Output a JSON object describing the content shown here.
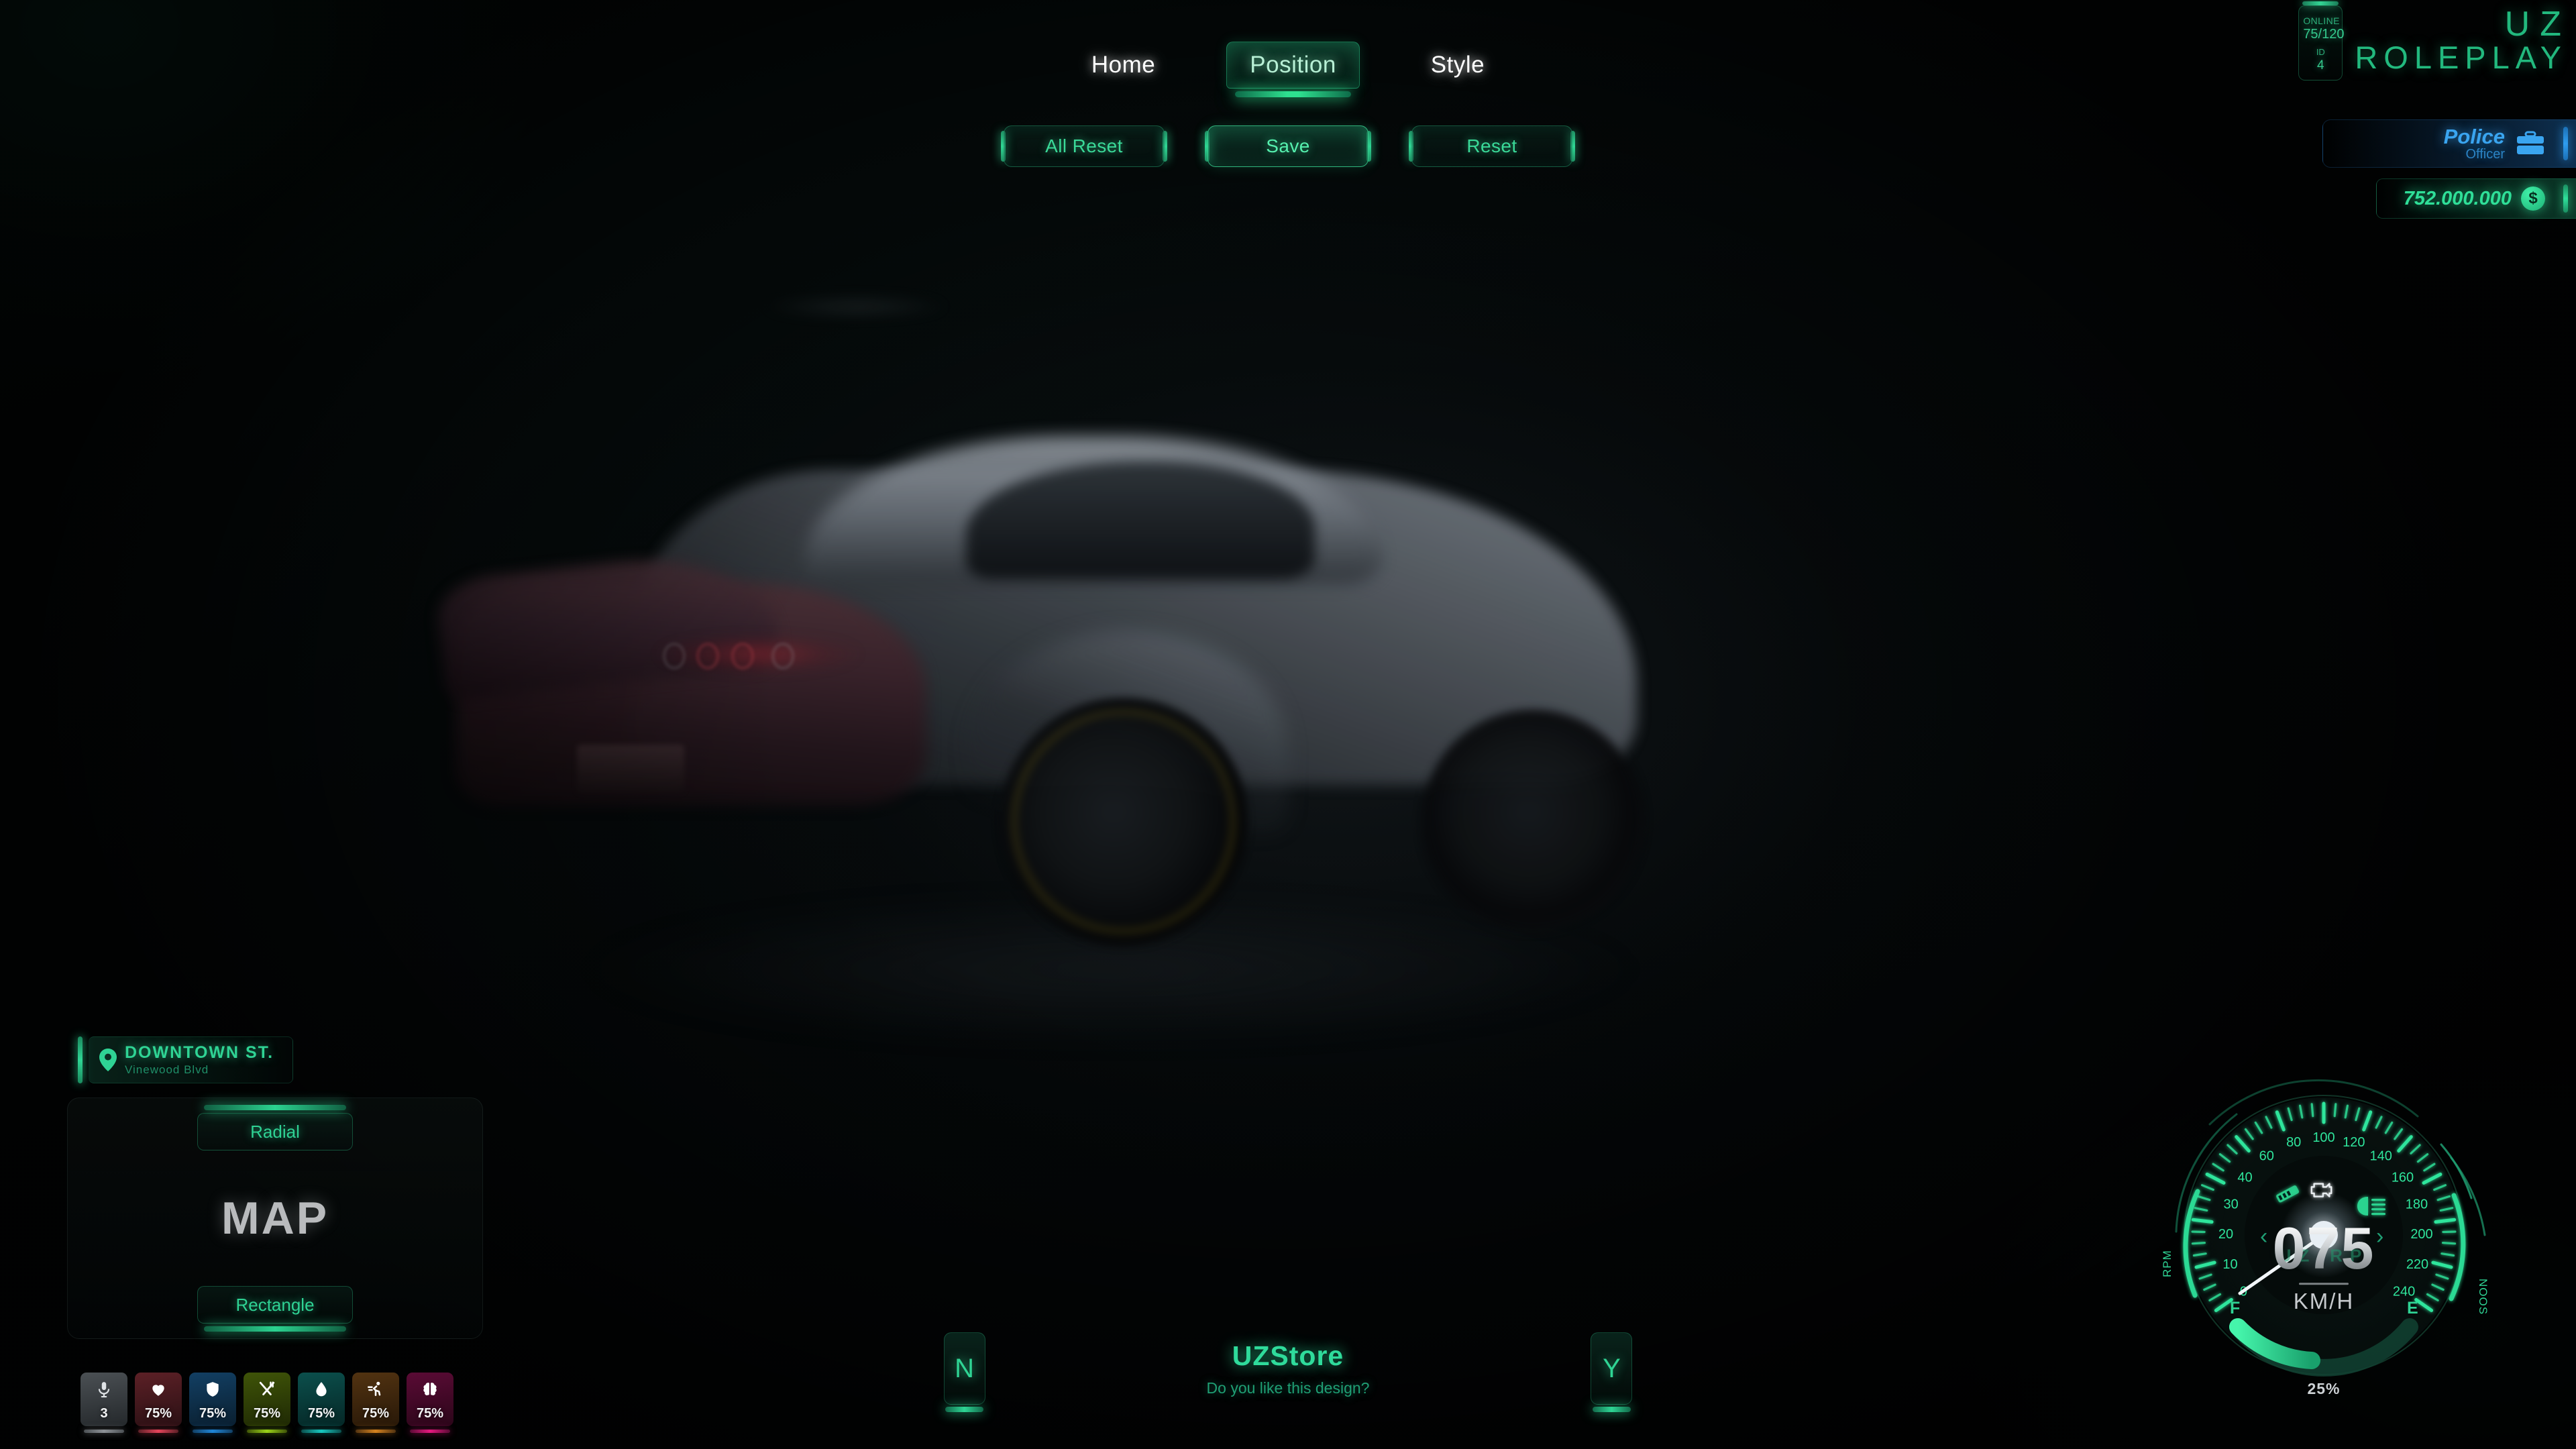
{
  "nav": {
    "items": [
      {
        "label": "Home",
        "active": false
      },
      {
        "label": "Position",
        "active": true
      },
      {
        "label": "Style",
        "active": false
      }
    ]
  },
  "actions": {
    "all_reset": "All Reset",
    "save": "Save",
    "reset": "Reset"
  },
  "brand": {
    "online_label": "ONLINE",
    "online_value": "75/120",
    "id_label": "ID",
    "id_value": "4",
    "logo_line1": "UZ",
    "logo_line2": "ROLEPLAY"
  },
  "job": {
    "title": "Police",
    "rank": "Officer",
    "icon": "briefcase-icon",
    "color": "#3aa5f0"
  },
  "money": {
    "amount": "752.000.000",
    "currency_symbol": "$",
    "color": "#2fdf98"
  },
  "location": {
    "street": "DOWNTOWN ST.",
    "zone": "Vinewood Blvd",
    "icon": "map-pin-icon"
  },
  "map_panel": {
    "shape_top": "Radial",
    "title": "MAP",
    "shape_bottom": "Rectangle"
  },
  "status": [
    {
      "name": "voice",
      "icon": "microphone-icon",
      "value": "3",
      "color": "#8d9296",
      "bg_from": "#4b5054",
      "bg_to": "#24282b"
    },
    {
      "name": "health",
      "icon": "heart-icon",
      "value": "75%",
      "color": "#e4445a",
      "bg_from": "#5c2026",
      "bg_to": "#2a1014"
    },
    {
      "name": "armor",
      "icon": "shield-icon",
      "value": "75%",
      "color": "#1f86d8",
      "bg_from": "#123f63",
      "bg_to": "#0a1f30"
    },
    {
      "name": "hunger",
      "icon": "cutlery-icon",
      "value": "75%",
      "color": "#9ad318",
      "bg_from": "#3f5408",
      "bg_to": "#1f2904"
    },
    {
      "name": "thirst",
      "icon": "droplet-icon",
      "value": "75%",
      "color": "#17c8c0",
      "bg_from": "#0b4f4c",
      "bg_to": "#052726"
    },
    {
      "name": "stamina",
      "icon": "runner-icon",
      "value": "75%",
      "color": "#d4821f",
      "bg_from": "#523311",
      "bg_to": "#281808"
    },
    {
      "name": "stress",
      "icon": "brain-icon",
      "value": "75%",
      "color": "#e5197f",
      "bg_from": "#5a0b35",
      "bg_to": "#2b0619"
    }
  ],
  "prompt": {
    "key_no": "N",
    "title": "UZStore",
    "question": "Do you like this design?",
    "key_yes": "Y"
  },
  "speedometer": {
    "speed": "075",
    "unit": "KM/H",
    "brand_text": "UZ-RP",
    "fuel_percent": "25%",
    "fuel_full_label": "F",
    "fuel_empty_label": "E",
    "rpm_label": "RPM",
    "nos_label": "NOOS",
    "ticks": [
      "0",
      "10",
      "20",
      "30",
      "40",
      "60",
      "80",
      "100",
      "120",
      "140",
      "160",
      "180",
      "200",
      "220",
      "240"
    ],
    "indicators": [
      {
        "name": "engine-icon",
        "state": "on",
        "color": "#e9edf0"
      },
      {
        "name": "seatbelt-icon",
        "state": "on",
        "color": "#2bd38f"
      },
      {
        "name": "headlight-icon",
        "state": "on",
        "color": "#2bd38f"
      }
    ],
    "left_chevron": "‹",
    "right_chevron": "›"
  },
  "theme": {
    "accent_green": "#2fd294",
    "accent_blue": "#3aa5f0",
    "bg": "#05090a"
  }
}
